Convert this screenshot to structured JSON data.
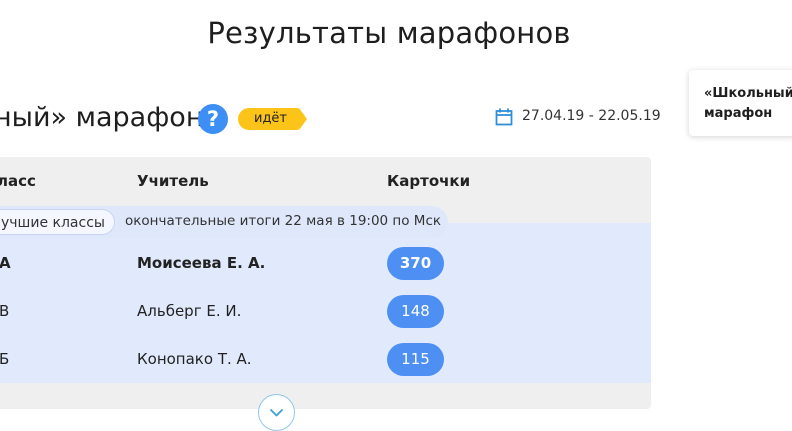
{
  "page": {
    "title": "Результаты марафонов"
  },
  "marathon": {
    "title_fragment": "ный» марафон",
    "status": "идёт",
    "dates": "27.04.19 - 22.05.19",
    "help_glyph": "?"
  },
  "table": {
    "headers": {
      "class": "ласс",
      "teacher": "Учитель",
      "cards": "Карточки"
    },
    "best_label": "учшие классы",
    "final_note": "окончательные итоги 22 мая в 19:00 по Мск",
    "rows": [
      {
        "class": "А",
        "teacher": "Моисеева Е. А.",
        "cards": "370",
        "highlight": true
      },
      {
        "class": "В",
        "teacher": "Альберг Е. И.",
        "cards": "148",
        "highlight": false
      },
      {
        "class": "Б",
        "teacher": "Конопако Т. А.",
        "cards": "115",
        "highlight": false
      }
    ]
  },
  "side_card": {
    "title": "«Школьный марафон"
  },
  "icons": {
    "help": "question-icon",
    "calendar": "calendar-icon",
    "expand": "chevron-down-icon"
  },
  "colors": {
    "accent_blue": "#4d8ff3",
    "status_yellow": "#fcc419",
    "row_highlight": "#e1eafc"
  }
}
